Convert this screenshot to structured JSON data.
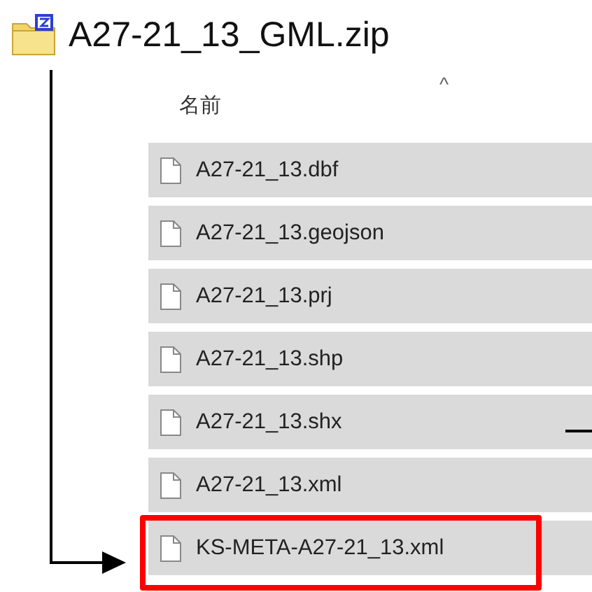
{
  "archive": {
    "name": "A27-21_13_GML.zip"
  },
  "column_header": {
    "label": "名前",
    "sort_indicator": "^"
  },
  "files": [
    {
      "name": "A27-21_13.dbf",
      "highlighted": false
    },
    {
      "name": "A27-21_13.geojson",
      "highlighted": false
    },
    {
      "name": "A27-21_13.prj",
      "highlighted": false
    },
    {
      "name": "A27-21_13.shp",
      "highlighted": false
    },
    {
      "name": "A27-21_13.shx",
      "highlighted": false
    },
    {
      "name": "A27-21_13.xml",
      "highlighted": false
    },
    {
      "name": "KS-META-A27-21_13.xml",
      "highlighted": true
    }
  ]
}
